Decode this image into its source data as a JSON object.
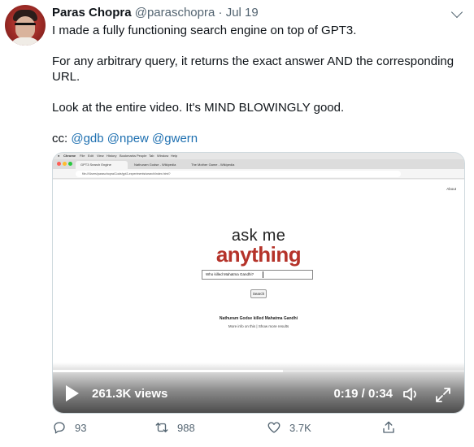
{
  "author": {
    "name": "Paras Chopra",
    "handle": "@paraschopra",
    "separator": "·",
    "date": "Jul 19"
  },
  "tweet": {
    "para1": "I made a fully functioning search engine on top of GPT3.",
    "para2": "For any arbitrary query, it returns the exact answer AND the corresponding URL.",
    "para3": "Look at the entire video. It's MIND BLOWINGLY good.",
    "cc_prefix": "cc: ",
    "mentions": [
      "@gdb",
      "@npew",
      "@gwern"
    ]
  },
  "video": {
    "browser": {
      "menu": [
        "Chrome",
        "File",
        "Edit",
        "View",
        "History",
        "Bookmarks",
        "People",
        "Tab",
        "Window",
        "Help"
      ],
      "tabs": [
        "GPT3 Search Engine",
        "Nathuram Godse - Wikipedia",
        "The Mother Game - Wikipedia"
      ],
      "url": "file:///Users/paraschopra/Code/gpt3-experiments/search/index.html?"
    },
    "page": {
      "about_link": "About",
      "logo_top": "ask me",
      "logo_bottom": "anything",
      "query": "Who killed Mahatma Gandhi?",
      "search_button": "Search",
      "answer": "Nathuram Godse killed Mahatma Gandhi",
      "more_info": "More info on this | Show more results"
    },
    "player": {
      "views": "261.3K views",
      "time": "0:19 / 0:34",
      "progress": 0.56
    }
  },
  "actions": {
    "replies": "93",
    "retweets": "988",
    "likes": "3.7K"
  },
  "colors": {
    "text": "#0f1419",
    "muted": "#536471",
    "link": "#1d6fb0",
    "logo_red": "#b5332a"
  }
}
